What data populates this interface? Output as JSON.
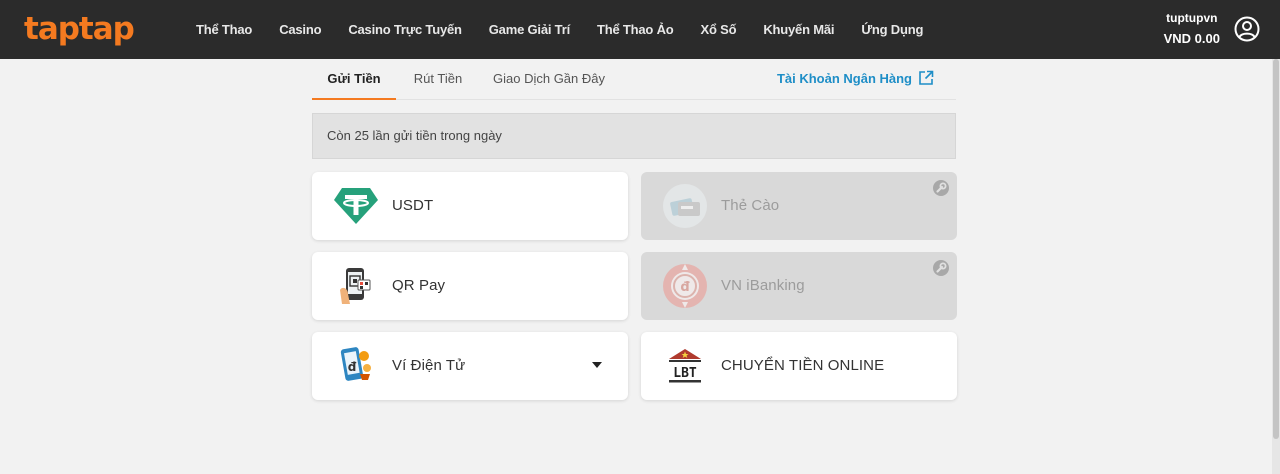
{
  "header": {
    "logo": "taptap",
    "nav": [
      "Thể Thao",
      "Casino",
      "Casino Trực Tuyến",
      "Game Giải Trí",
      "Thể Thao Ảo",
      "Xổ Số",
      "Khuyến Mãi",
      "Ứng Dụng"
    ],
    "username": "tuptupvn",
    "balance": "VND 0.00",
    "user_icon": "user-circle-icon"
  },
  "tabs": {
    "items": [
      "Gửi Tiền",
      "Rút Tiền",
      "Giao Dịch Gần Đây"
    ],
    "active": "Gửi Tiền",
    "bank_link": "Tài Khoản Ngân Hàng",
    "bank_link_icon": "external-link-icon"
  },
  "notice": "Còn 25 lần gửi tiền trong ngày",
  "methods": [
    {
      "label": "USDT",
      "icon": "tether-icon",
      "enabled": true
    },
    {
      "label": "Thẻ Cào",
      "icon": "scratch-card-icon",
      "enabled": false,
      "status_icon": "maintenance-icon"
    },
    {
      "label": "QR Pay",
      "icon": "qr-phone-icon",
      "enabled": true
    },
    {
      "label": "VN iBanking",
      "icon": "ibanking-icon",
      "enabled": false,
      "status_icon": "maintenance-icon"
    },
    {
      "label": "Ví Điện Tử",
      "icon": "e-wallet-icon",
      "enabled": true,
      "dropdown": true
    },
    {
      "label": "CHUYỂN TIỀN ONLINE",
      "icon": "lbt-bank-icon",
      "enabled": true
    }
  ],
  "colors": {
    "accent": "#f47a20",
    "link": "#1e8ec7",
    "header_bg": "#2b2b2b",
    "tether": "#26a17b"
  }
}
